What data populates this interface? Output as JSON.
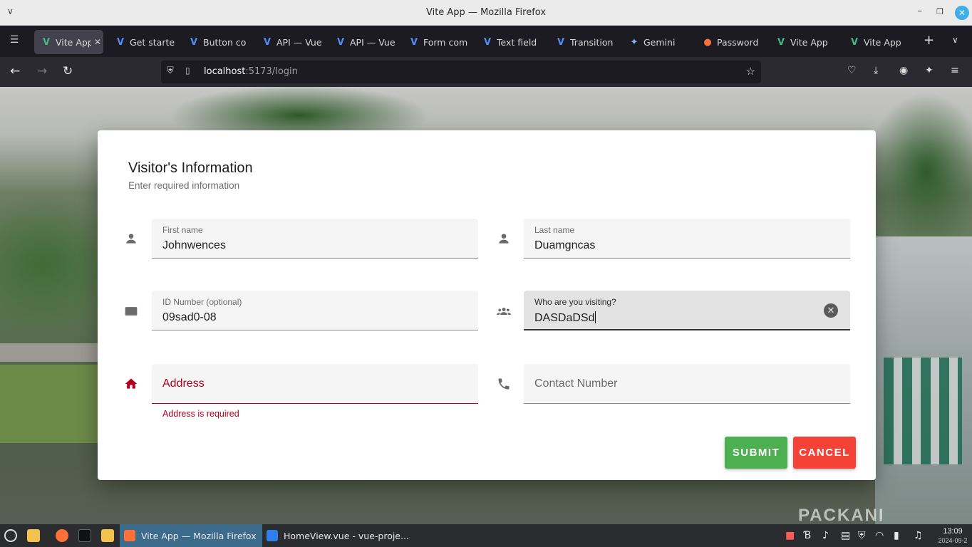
{
  "window": {
    "title": "Vite App — Mozilla Firefox"
  },
  "tabs": [
    {
      "label": "Vite App",
      "icon": "vite-icon",
      "color": "#41b883",
      "active": true
    },
    {
      "label": "Get starte",
      "icon": "vuetify-icon",
      "color": "#4f8ef7"
    },
    {
      "label": "Button co",
      "icon": "vuetify-icon",
      "color": "#4f8ef7"
    },
    {
      "label": "API — Vue",
      "icon": "vuetify-icon",
      "color": "#4f8ef7"
    },
    {
      "label": "API — Vue",
      "icon": "vuetify-icon",
      "color": "#4f8ef7"
    },
    {
      "label": "Form com",
      "icon": "vuetify-icon",
      "color": "#4f8ef7"
    },
    {
      "label": "Text field",
      "icon": "vuetify-icon",
      "color": "#4f8ef7"
    },
    {
      "label": "Transition",
      "icon": "vuetify-icon",
      "color": "#4f8ef7"
    },
    {
      "label": "Gemini",
      "icon": "gemini-icon",
      "color": "#8ab4f8"
    },
    {
      "label": "Password",
      "icon": "firefox-icon",
      "color": "#ff7139"
    },
    {
      "label": "Vite App",
      "icon": "vite-icon",
      "color": "#41b883"
    },
    {
      "label": "Vite App",
      "icon": "vite-icon",
      "color": "#41b883"
    }
  ],
  "url": {
    "host": "localhost",
    "path": ":5173/login"
  },
  "dialog": {
    "title": "Visitor's Information",
    "subtitle": "Enter required information",
    "fields": {
      "first_name": {
        "label": "First name",
        "value": "Johnwences",
        "icon": "person-icon"
      },
      "last_name": {
        "label": "Last name",
        "value": "Duamgncas",
        "icon": "person-icon"
      },
      "id_number": {
        "label": "ID Number (optional)",
        "value": "09sad0-08",
        "icon": "id-card-icon"
      },
      "visiting": {
        "label": "Who are you visiting?",
        "value": "DASDaDSd",
        "icon": "group-icon",
        "focused": true
      },
      "address": {
        "placeholder": "Address",
        "error": "Address is required",
        "icon": "home-icon"
      },
      "contact": {
        "placeholder": "Contact Number",
        "icon": "phone-icon"
      }
    },
    "buttons": {
      "submit": "SUBMIT",
      "cancel": "CANCEL"
    },
    "colors": {
      "error": "#b00020",
      "submit": "#4caf50",
      "cancel": "#f44336"
    }
  },
  "background": {
    "watermark": "PACKANI"
  },
  "taskbar": {
    "tasks": [
      {
        "label": "Vite App — Mozilla Firefox",
        "active": true
      },
      {
        "label": "HomeView.vue - vue-proje..."
      }
    ],
    "clock": {
      "time": "13:09",
      "date": "2024-09-2"
    }
  }
}
